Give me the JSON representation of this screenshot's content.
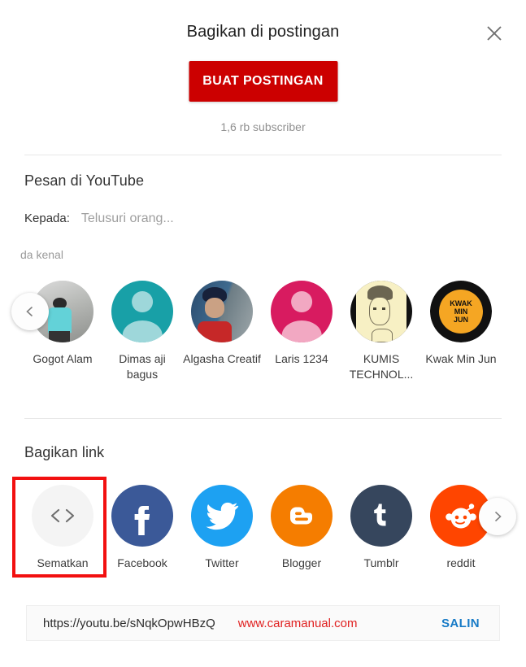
{
  "header": {
    "title": "Bagikan di postingan",
    "close_icon": "close-icon",
    "post_button_label": "BUAT POSTINGAN",
    "subscriber_count": "1,6 rb subscriber"
  },
  "message_section": {
    "title": "Pesan di YouTube",
    "to_label": "Kepada:",
    "to_placeholder": "Telusuri orang...",
    "to_value": "",
    "suggestion_label": "da kenal",
    "prev_arrow_icon": "chevron-left-icon",
    "people": [
      {
        "name": "Gogot Alam",
        "avatar_type": "photo",
        "color": "#9aa7ad"
      },
      {
        "name": "Dimas aji bagus",
        "avatar_type": "default",
        "color": "#18A0A7"
      },
      {
        "name": "Algasha Creatif",
        "avatar_type": "photo",
        "color": "#2e4a66"
      },
      {
        "name": "Laris 1234",
        "avatar_type": "default",
        "color": "#D81B60"
      },
      {
        "name": "KUMIS TECHNOL...",
        "avatar_type": "sketch",
        "color": "#F7F0C4"
      },
      {
        "name": "Kwak Min Jun",
        "avatar_type": "kwak",
        "color": "#F5A623"
      }
    ]
  },
  "link_section": {
    "title": "Bagikan link",
    "next_arrow_icon": "chevron-right-icon",
    "highlighted_item": "Sematkan",
    "items": [
      {
        "name": "Sematkan",
        "icon": "embed-code-icon",
        "color": "#f4f4f4"
      },
      {
        "name": "Facebook",
        "icon": "facebook-icon",
        "color": "#3B5998"
      },
      {
        "name": "Twitter",
        "icon": "twitter-icon",
        "color": "#1DA1F2"
      },
      {
        "name": "Blogger",
        "icon": "blogger-icon",
        "color": "#F57D00"
      },
      {
        "name": "Tumblr",
        "icon": "tumblr-icon",
        "color": "#36465D"
      },
      {
        "name": "reddit",
        "icon": "reddit-icon",
        "color": "#FF4500"
      }
    ]
  },
  "url_bar": {
    "url": "https://youtu.be/sNqkOpwHBzQ",
    "watermark": "www.caramanual.com",
    "copy_label": "SALIN"
  },
  "colors": {
    "brand_red": "#CC0000",
    "highlight_red": "#f21010",
    "link_blue": "#167ac6",
    "watermark_red": "#e02020"
  },
  "kwak_badge": {
    "l1": "KWAK",
    "l2": "MIN",
    "l3": "JUN"
  }
}
